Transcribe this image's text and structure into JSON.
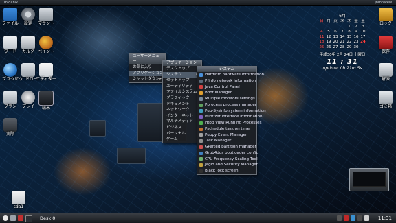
{
  "topbar": {
    "left_label": "midanw",
    "right_label": "jnmnafew"
  },
  "desktop_left": [
    {
      "label": "ファイル",
      "icon": "folder-icon"
    },
    {
      "label": "設定",
      "icon": "gear-icon"
    },
    {
      "label": "マウント",
      "icon": "drive-icon"
    },
    {
      "label": "ワード",
      "icon": "document-icon"
    },
    {
      "label": "カルク",
      "icon": "calculator-icon"
    },
    {
      "label": "ペイント",
      "icon": "paint-icon"
    },
    {
      "label": "ブラウザ",
      "icon": "globe-icon"
    },
    {
      "label": "ウ..ドロー",
      "icon": "window-icon"
    },
    {
      "label": "エディター",
      "icon": "edit-icon"
    },
    {
      "label": "プラン",
      "icon": "plan-icon"
    },
    {
      "label": "プレイ",
      "icon": "play-icon"
    },
    {
      "label": "端末",
      "icon": "terminal-icon"
    },
    {
      "label": "実際",
      "icon": "install-icon"
    }
  ],
  "desktop_right": [
    {
      "label": "ロック",
      "icon": "lock-icon"
    },
    {
      "label": "保存",
      "icon": "save-icon"
    },
    {
      "label": "解凍",
      "icon": "unpack-icon"
    },
    {
      "label": "ゴミ箱",
      "icon": "trash-icon"
    }
  ],
  "drive": {
    "label": "sda1"
  },
  "calendar": {
    "month_title": "6月",
    "weekdays": [
      "日",
      "月",
      "火",
      "水",
      "木",
      "金",
      "土"
    ],
    "rows": [
      [
        "",
        "",
        "",
        "",
        "1",
        "2",
        "3"
      ],
      [
        "4",
        "5",
        "6",
        "7",
        "8",
        "9",
        "10"
      ],
      [
        "11",
        "12",
        "13",
        "14",
        "15",
        "16",
        "17"
      ],
      [
        "18",
        "19",
        "20",
        "21",
        "22",
        "23",
        "24"
      ],
      [
        "25",
        "26",
        "27",
        "28",
        "29",
        "30",
        ""
      ]
    ],
    "today": "24",
    "date_text": "平成30年 2月 24日 土曜日",
    "time": "11 : 31",
    "uptime": "uptime: 0h 21m 5s"
  },
  "user_menu": {
    "title": "ユーザーメニュー",
    "items": [
      {
        "label": "お気に入り",
        "selected": false
      },
      {
        "label": "アプリケーション",
        "selected": true
      },
      {
        "label": "シャットダウン",
        "selected": false
      }
    ]
  },
  "app_menu": {
    "title": "アプリケーション",
    "items": [
      {
        "label": "デスクトップ",
        "selected": false
      },
      {
        "label": "システム",
        "selected": true
      },
      {
        "label": "セットアップ",
        "selected": false
      },
      {
        "label": "ユーティリティ",
        "selected": false
      },
      {
        "label": "ファイルシステム",
        "selected": false
      },
      {
        "label": "グラフィック",
        "selected": false
      },
      {
        "label": "ドキュメント",
        "selected": false
      },
      {
        "label": "ネットワーク",
        "selected": false
      },
      {
        "label": "インターネット",
        "selected": false
      },
      {
        "label": "マルチメディア",
        "selected": false
      },
      {
        "label": "ビジネス",
        "selected": false
      },
      {
        "label": "パーソナル",
        "selected": false
      },
      {
        "label": "ゲーム",
        "selected": false
      }
    ]
  },
  "system_menu": {
    "title": "システム",
    "items": [
      {
        "label": "Hardinfo hardware information",
        "color": "#4a90d9"
      },
      {
        "label": "Pfinfo network information",
        "color": "#5a6a7a"
      },
      {
        "label": "Java Control Panel",
        "color": "#d04040"
      },
      {
        "label": "Boot Manager",
        "color": "#e0a030"
      },
      {
        "label": "Multiple monitors settings",
        "color": "#7a8a9a"
      },
      {
        "label": "Pprocess process manager",
        "color": "#60a060"
      },
      {
        "label": "Pup-Sysinfo system information",
        "color": "#40a0c0"
      },
      {
        "label": "Puptizer interface information",
        "color": "#8060c0"
      },
      {
        "label": "Htop View Running Processes",
        "color": "#50b050"
      },
      {
        "label": "Pschedule task on time",
        "color": "#c07030"
      },
      {
        "label": "Puppy Event Manager",
        "color": "#a0a0a0"
      },
      {
        "label": "Task Manager",
        "color": "#909090"
      },
      {
        "label": "GParted partition manager",
        "color": "#d05050"
      },
      {
        "label": "Grub4dos bootloader config",
        "color": "#4080c0"
      },
      {
        "label": "CPU Frequency Scaling Tool",
        "color": "#70b070"
      },
      {
        "label": "Jaglo and Security Manager",
        "color": "#c0a040"
      },
      {
        "label": "Black lock screen",
        "color": "#303030"
      }
    ]
  },
  "taskbar": {
    "desk_label": "Desk 0",
    "clock": "11:31"
  },
  "colors": {
    "menu_head": "#5a6470",
    "accent": "#4f5c6b"
  }
}
